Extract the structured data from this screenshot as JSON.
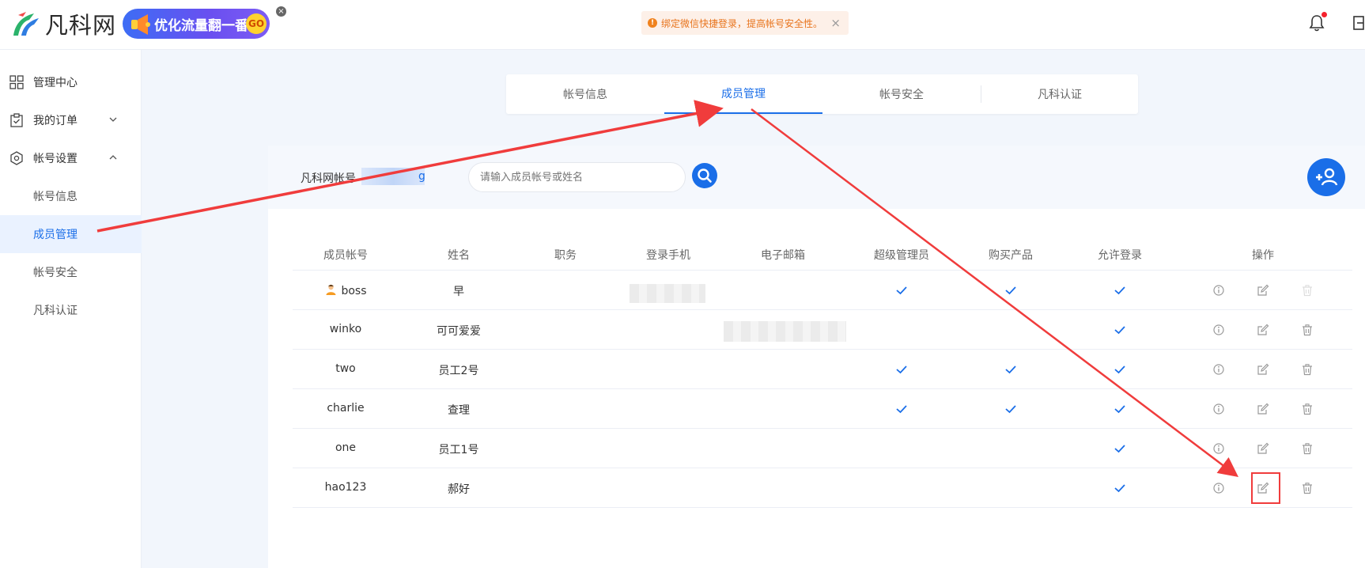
{
  "header": {
    "logo_text": "凡科网",
    "promo_text": "优化流量翻一番",
    "promo_go": "GO",
    "promo_close": "×",
    "notice_icon": "!",
    "notice_text": "绑定微信快捷登录，提高帐号安全性。",
    "notice_close": "×"
  },
  "sidebar": {
    "items": [
      {
        "label": "管理中心",
        "icon": "grid-icon"
      },
      {
        "label": "我的订单",
        "icon": "order-icon"
      },
      {
        "label": "帐号设置",
        "icon": "settings-icon"
      }
    ],
    "sub_items": [
      {
        "label": "帐号信息"
      },
      {
        "label": "成员管理",
        "active": true
      },
      {
        "label": "帐号安全"
      },
      {
        "label": "凡科认证"
      }
    ]
  },
  "tabs": [
    {
      "label": "帐号信息"
    },
    {
      "label": "成员管理",
      "active": true
    },
    {
      "label": "帐号安全"
    },
    {
      "label": "凡科认证"
    }
  ],
  "account": {
    "label": "凡科网帐号",
    "value": "g"
  },
  "search": {
    "placeholder": "请输入成员帐号或姓名"
  },
  "table": {
    "columns": [
      "成员帐号",
      "姓名",
      "职务",
      "登录手机",
      "电子邮箱",
      "超级管理员",
      "购买产品",
      "允许登录",
      "操作"
    ],
    "rows": [
      {
        "account": "boss",
        "name": "早",
        "title": "",
        "phone": "",
        "email": "",
        "super_admin": true,
        "buy": true,
        "login": true,
        "owner": true
      },
      {
        "account": "winko",
        "name": "可可爱爱",
        "title": "",
        "phone": "",
        "email": "",
        "super_admin": false,
        "buy": false,
        "login": true
      },
      {
        "account": "two",
        "name": "员工2号",
        "title": "",
        "phone": "",
        "email": "",
        "super_admin": true,
        "buy": true,
        "login": true
      },
      {
        "account": "charlie",
        "name": "查理",
        "title": "",
        "phone": "",
        "email": "",
        "super_admin": true,
        "buy": true,
        "login": true
      },
      {
        "account": "one",
        "name": "员工1号",
        "title": "",
        "phone": "",
        "email": "",
        "super_admin": false,
        "buy": false,
        "login": true
      },
      {
        "account": "hao123",
        "name": "郝好",
        "title": "",
        "phone": "",
        "email": "",
        "super_admin": false,
        "buy": false,
        "login": true
      }
    ]
  },
  "colors": {
    "primary": "#1a6ee8",
    "annotation_red": "#f03c3c",
    "notice_orange": "#e8741d"
  }
}
